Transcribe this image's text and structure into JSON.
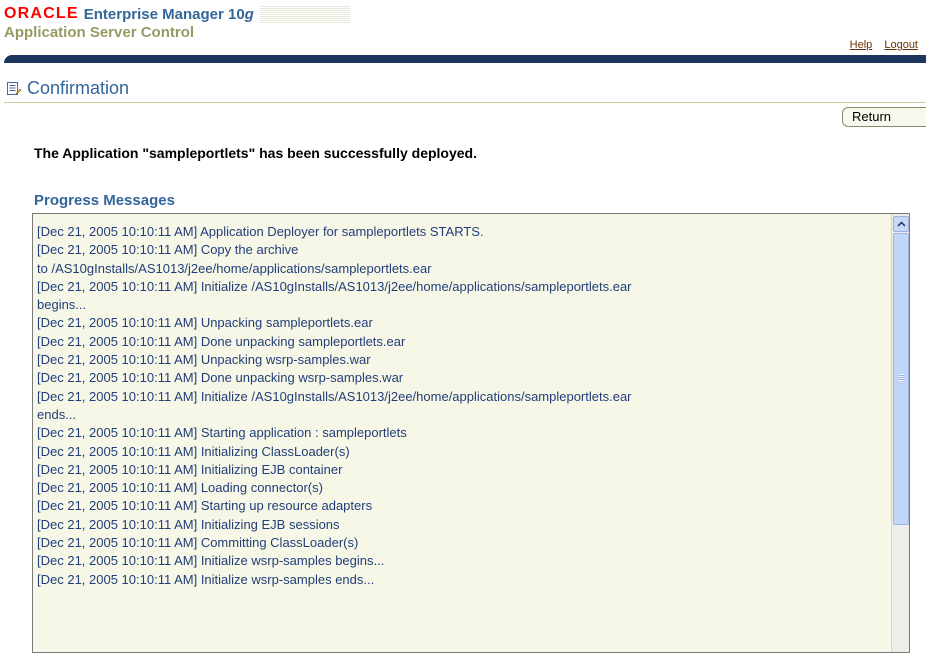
{
  "branding": {
    "oracle_logo": "ORACLE",
    "product_name": "Enterprise Manager 10",
    "product_version": "g",
    "application": "Application Server Control"
  },
  "global_links": {
    "help": "Help",
    "logout": "Logout"
  },
  "page": {
    "title": "Confirmation",
    "title_icon": "document-icon",
    "return_button": "Return",
    "confirmation_message": "The Application \"sampleportlets\" has been successfully deployed."
  },
  "progress": {
    "heading": "Progress Messages",
    "lines": [
      "[Dec 21, 2005 10:10:11 AM] Application Deployer for sampleportlets STARTS.",
      "[Dec 21, 2005 10:10:11 AM] Copy the archive",
      "to /AS10gInstalls/AS1013/j2ee/home/applications/sampleportlets.ear",
      "[Dec 21, 2005 10:10:11 AM] Initialize /AS10gInstalls/AS1013/j2ee/home/applications/sampleportlets.ear",
      "begins...",
      "[Dec 21, 2005 10:10:11 AM] Unpacking sampleportlets.ear",
      "[Dec 21, 2005 10:10:11 AM] Done unpacking sampleportlets.ear",
      "[Dec 21, 2005 10:10:11 AM] Unpacking wsrp-samples.war",
      "[Dec 21, 2005 10:10:11 AM] Done unpacking wsrp-samples.war",
      "[Dec 21, 2005 10:10:11 AM] Initialize /AS10gInstalls/AS1013/j2ee/home/applications/sampleportlets.ear",
      "ends...",
      "[Dec 21, 2005 10:10:11 AM] Starting application : sampleportlets",
      "[Dec 21, 2005 10:10:11 AM] Initializing ClassLoader(s)",
      "[Dec 21, 2005 10:10:11 AM] Initializing EJB container",
      "[Dec 21, 2005 10:10:11 AM] Loading connector(s)",
      "[Dec 21, 2005 10:10:11 AM] Starting up resource adapters",
      "[Dec 21, 2005 10:10:11 AM] Initializing EJB sessions",
      "[Dec 21, 2005 10:10:11 AM] Committing ClassLoader(s)",
      "[Dec 21, 2005 10:10:11 AM] Initialize wsrp-samples begins...",
      "[Dec 21, 2005 10:10:11 AM] Initialize wsrp-samples ends..."
    ]
  },
  "colors": {
    "brand_red": "#ff0000",
    "accent_blue": "#336699",
    "subtitle_olive": "#999966",
    "header_bar": "#1b355d",
    "log_background": "#f7f7e7",
    "log_text": "#223e7a",
    "link_brown": "#663300"
  }
}
